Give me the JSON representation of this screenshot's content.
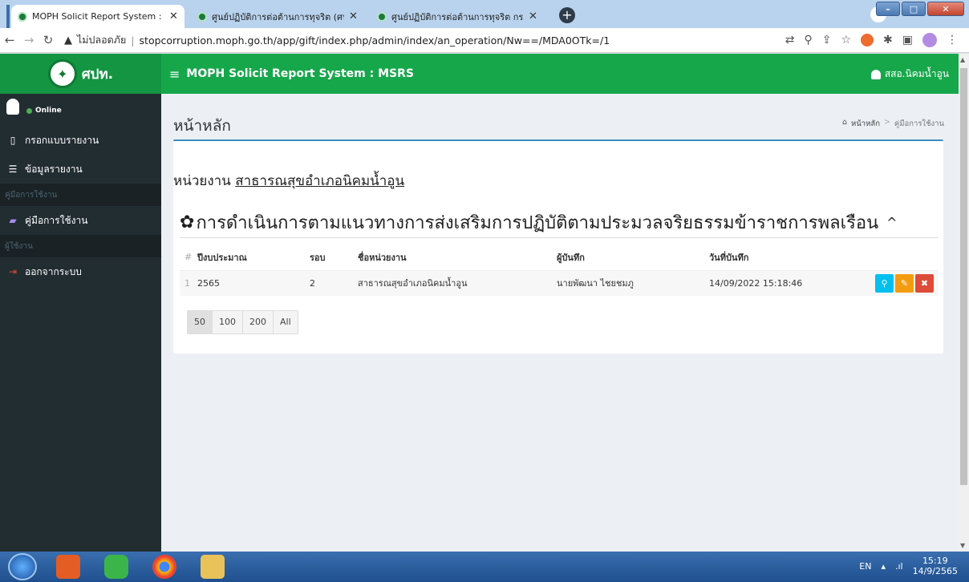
{
  "browser": {
    "tabs": [
      {
        "title": "MOPH Solicit Report System : MS",
        "active": true
      },
      {
        "title": "ศูนย์ปฏิบัติการต่อต้านการทุจริต (ศปท",
        "active": false
      },
      {
        "title": "ศูนย์ปฏิบัติการต่อต้านการทุจริต กระ",
        "active": false
      }
    ],
    "security_label": "ไม่ปลอดภัย",
    "url": "stopcorruption.moph.go.th/app/gift/index.php/admin/index/an_operation/Nw==/MDA0OTk=/1"
  },
  "header": {
    "logo_text": "ศปท.",
    "system_title": "MOPH Solicit Report System : MSRS",
    "user_name": "สสอ.นิคมน้ำอูน"
  },
  "sidebar": {
    "status": "Online",
    "items": [
      {
        "label": "กรอกแบบรายงาน",
        "icon": "file-icon"
      },
      {
        "label": "ข้อมูลรายงาน",
        "icon": "list-icon"
      }
    ],
    "section_manual": "คู่มือการใช้งาน",
    "manual_item": "คู่มือการใช้งาน",
    "section_user": "ผู้ใช้งาน",
    "logout_item": "ออกจากระบบ"
  },
  "page": {
    "title": "หน้าหลัก",
    "breadcrumb": [
      "หน้าหลัก",
      "คู่มือการใช้งาน"
    ],
    "unit_label": "หน่วยงาน",
    "unit_name": "สาธารณสุขอำเภอนิคมน้ำอูน",
    "section_title": "การดำเนินการตามแนวทางการส่งเสริมการปฏิบัติตามประมวลจริยธรรมข้าราชการพลเรือน"
  },
  "table": {
    "headers": [
      "#",
      "ปีงบประมาณ",
      "รอบ",
      "ชื่อหน่วยงาน",
      "ผู้บันทึก",
      "วันที่บันทึก"
    ],
    "rows": [
      {
        "idx": "1",
        "year": "2565",
        "round": "2",
        "unit": "สาธารณสุขอำเภอนิคมน้ำอูน",
        "recorder": "นายพัฒนา ไชยชมภู",
        "date": "14/09/2022 15:18:46"
      }
    ]
  },
  "pager": [
    "50",
    "100",
    "200",
    "All"
  ],
  "taskbar": {
    "lang": "EN",
    "time": "15:19",
    "date": "14/9/2565"
  }
}
